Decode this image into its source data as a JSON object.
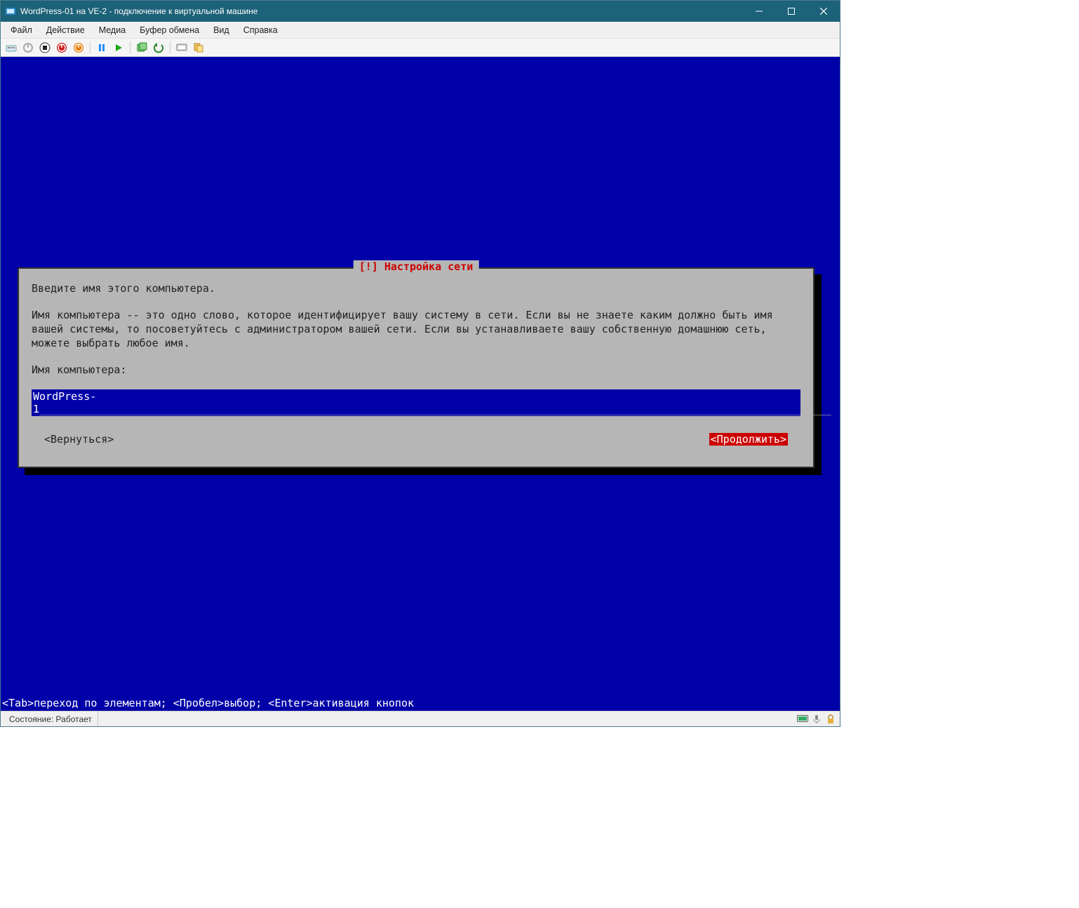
{
  "window": {
    "title": "WordPress-01 на VE-2 - подключение к виртуальной машине"
  },
  "menu": {
    "file": "Файл",
    "action": "Действие",
    "media": "Медиа",
    "clipboard": "Буфер обмена",
    "view": "Вид",
    "help": "Справка"
  },
  "toolbar_icons": {
    "ctrl_alt_del": "ctrl-alt-del-icon",
    "power_off_gray": "power-gray-icon",
    "stop": "stop-icon",
    "shutdown": "shutdown-icon",
    "reset": "reset-icon",
    "pause": "pause-icon",
    "start": "start-icon",
    "checkpoint": "checkpoint-icon",
    "revert": "revert-icon",
    "enhanced": "enhanced-session-icon",
    "share": "share-icon"
  },
  "installer": {
    "title": "[!] Настройка сети",
    "prompt": "Введите имя этого компьютера.",
    "explain": "Имя компьютера -- это одно слово, которое идентифицирует вашу систему в сети. Если вы не знаете каким должно быть имя вашей системы, то посоветуйтесь с администратором вашей сети. Если вы устанавливаете вашу собственную домашнюю сеть, можете выбрать любое имя.",
    "field_label": "Имя компьютера:",
    "field_value": "WordPress-1",
    "btn_back": "<Вернуться>",
    "btn_continue": "<Продолжить>",
    "hint": "<Tab>переход по элементам; <Пробел>выбор; <Enter>активация кнопок"
  },
  "status": {
    "text": "Состояние: Работает"
  }
}
